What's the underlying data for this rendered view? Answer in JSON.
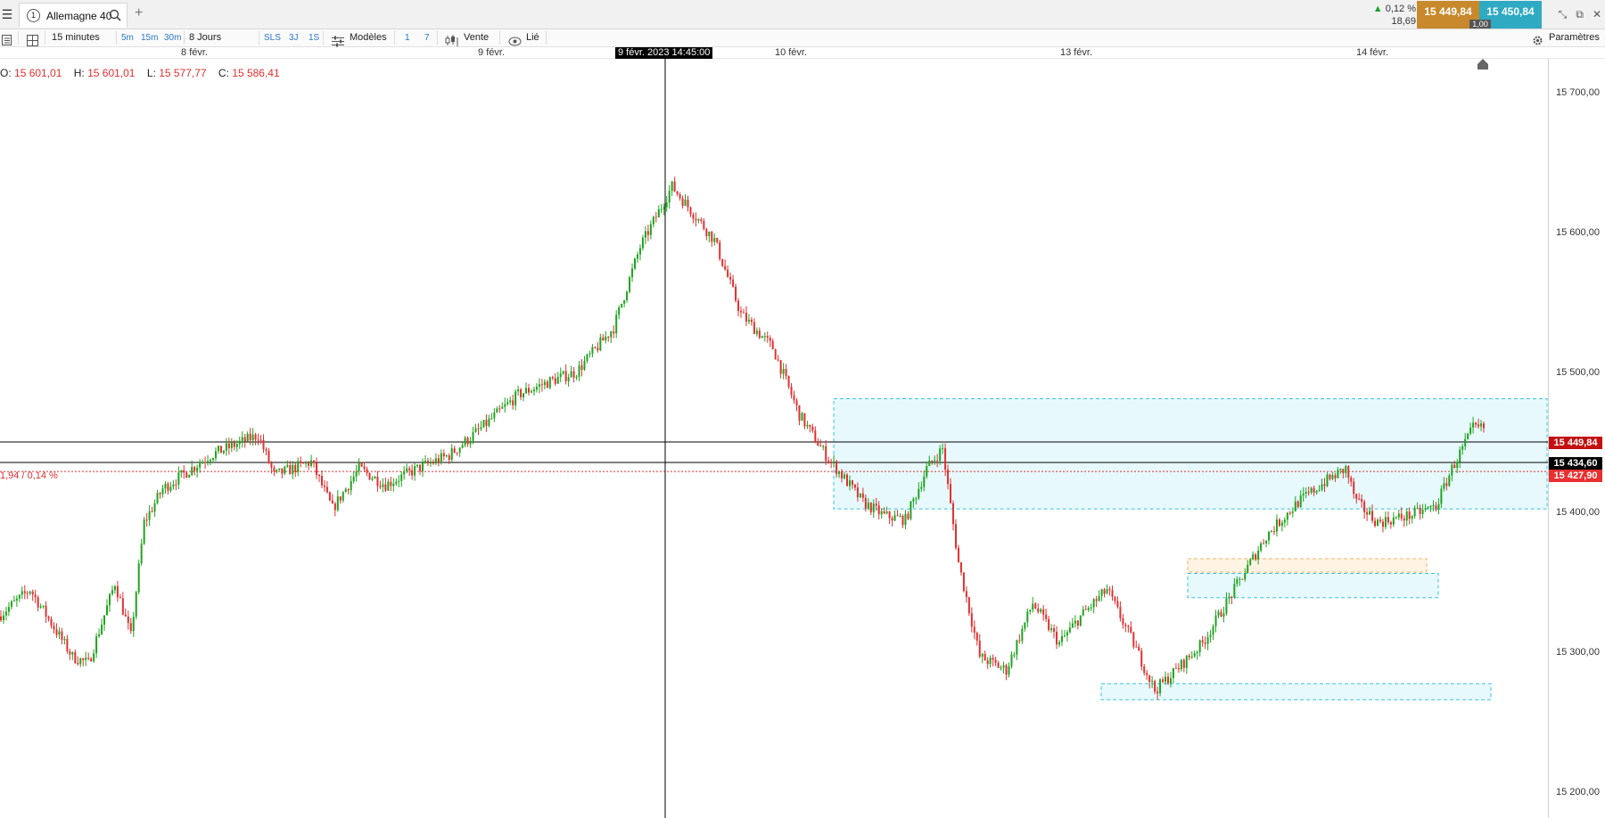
{
  "tab": {
    "number": "1",
    "label": "Allemagne 40"
  },
  "quote": {
    "change_pct": "0,12 %",
    "change_abs": "18,69",
    "sell": "15 449,84",
    "buy": "15 450,84",
    "qty": "1,00"
  },
  "toolbar": {
    "interval": "15 minutes",
    "quick_intervals": [
      "5m",
      "15m",
      "30m"
    ],
    "range": "8 Jours",
    "quick_ranges": [
      "SLS",
      "3J",
      "1S"
    ],
    "models": "Modèles",
    "buttons_num": [
      "1",
      "7"
    ],
    "sell": "Vente",
    "linked": "Lié",
    "settings": "Paramètres"
  },
  "dates": {
    "d1": "8 févr.",
    "d2": "9 févr.",
    "d3": "10 févr.",
    "d4": "13 févr.",
    "d5": "14 févr."
  },
  "crosshair_date": "9 févr. 2023 14:45:00",
  "ohlc": {
    "o_label": "O:",
    "o": "15 601,01",
    "h_label": "H:",
    "h": "15 601,01",
    "l_label": "L:",
    "l": "15 577,77",
    "c_label": "C:",
    "c": "15 586,41"
  },
  "pct_label": "1,94 / 0,14 %",
  "yticks": {
    "t1": "15 700,00",
    "t2": "15 600,00",
    "t3": "15 500,00",
    "t4": "15 400,00",
    "t5": "15 300,00",
    "t6": "15 200,00"
  },
  "price_tags": {
    "ask": "15 449,84",
    "crosshair": "15 434,60",
    "last": "15 427,90"
  },
  "colors": {
    "up": "#1fa31f",
    "down": "#e03030",
    "zone_fill": "#e3f8fc",
    "zone_stroke": "#39c4dc",
    "orange_zone": "#f2b56a",
    "sell_bg": "#c7892b",
    "buy_bg": "#2eaac2"
  },
  "chart_data": {
    "type": "candlestick",
    "instrument": "Allemagne 40",
    "interval": "15 minutes",
    "ylim": [
      15170,
      15735
    ],
    "x_labels": [
      "8 févr.",
      "9 févr.",
      "10 févr.",
      "13 févr.",
      "14 févr."
    ],
    "close_path": [
      [
        0,
        15320
      ],
      [
        12,
        15340
      ],
      [
        28,
        15290
      ],
      [
        34,
        15285
      ],
      [
        44,
        15345
      ],
      [
        50,
        15305
      ],
      [
        55,
        15390
      ],
      [
        62,
        15415
      ],
      [
        80,
        15440
      ],
      [
        98,
        15455
      ],
      [
        104,
        15425
      ],
      [
        118,
        15435
      ],
      [
        126,
        15400
      ],
      [
        136,
        15430
      ],
      [
        146,
        15418
      ],
      [
        158,
        15430
      ],
      [
        170,
        15440
      ],
      [
        182,
        15460
      ],
      [
        196,
        15485
      ],
      [
        208,
        15495
      ],
      [
        218,
        15502
      ],
      [
        232,
        15535
      ],
      [
        242,
        15595
      ],
      [
        254,
        15640
      ],
      [
        262,
        15620
      ],
      [
        270,
        15600
      ],
      [
        280,
        15545
      ],
      [
        292,
        15520
      ],
      [
        302,
        15470
      ],
      [
        312,
        15440
      ],
      [
        318,
        15425
      ],
      [
        326,
        15405
      ],
      [
        334,
        15395
      ],
      [
        342,
        15392
      ],
      [
        350,
        15430
      ],
      [
        356,
        15445
      ],
      [
        362,
        15360
      ],
      [
        370,
        15290
      ],
      [
        380,
        15280
      ],
      [
        390,
        15330
      ],
      [
        400,
        15300
      ],
      [
        408,
        15320
      ],
      [
        418,
        15340
      ],
      [
        428,
        15300
      ],
      [
        436,
        15265
      ],
      [
        444,
        15280
      ],
      [
        454,
        15300
      ],
      [
        466,
        15340
      ],
      [
        478,
        15380
      ],
      [
        490,
        15405
      ],
      [
        500,
        15420
      ],
      [
        508,
        15430
      ],
      [
        512,
        15405
      ],
      [
        520,
        15390
      ],
      [
        532,
        15395
      ],
      [
        542,
        15402
      ],
      [
        548,
        15430
      ],
      [
        552,
        15445
      ],
      [
        556,
        15460
      ]
    ],
    "zones": [
      {
        "color": "cyan",
        "from": 15400,
        "to": 15482
      },
      {
        "color": "orange",
        "from": 15353,
        "to": 15363
      },
      {
        "color": "cyan",
        "from": 15334,
        "to": 15352
      },
      {
        "color": "cyan",
        "from": 15258,
        "to": 15270
      }
    ],
    "hlines": [
      15449.84,
      15434.6,
      15427.9
    ],
    "last_price": 15427.9,
    "crosshair_price": 15434.6,
    "ask_price": 15449.84
  }
}
